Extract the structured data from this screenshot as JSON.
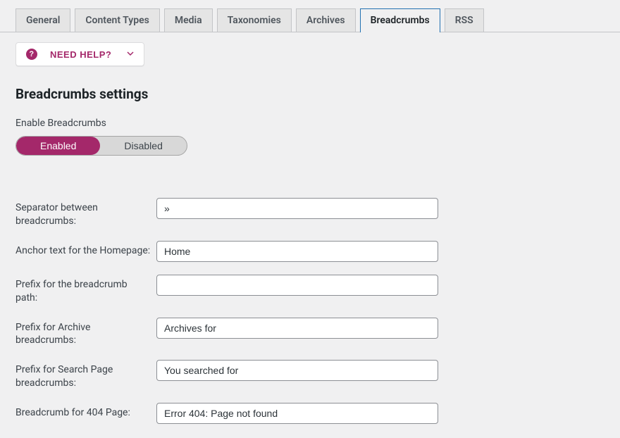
{
  "tabs": [
    {
      "label": "General"
    },
    {
      "label": "Content Types"
    },
    {
      "label": "Media"
    },
    {
      "label": "Taxonomies"
    },
    {
      "label": "Archives"
    },
    {
      "label": "Breadcrumbs"
    },
    {
      "label": "RSS"
    }
  ],
  "help_button": {
    "label": "NEED HELP?"
  },
  "section_title": "Breadcrumbs settings",
  "enable_label": "Enable Breadcrumbs",
  "toggle": {
    "enabled": "Enabled",
    "disabled": "Disabled"
  },
  "fields": {
    "separator": {
      "label": "Separator between breadcrumbs:",
      "value": "»"
    },
    "anchor": {
      "label": "Anchor text for the Homepage:",
      "value": "Home"
    },
    "prefix_path": {
      "label": "Prefix for the breadcrumb path:",
      "value": ""
    },
    "prefix_archive": {
      "label": "Prefix for Archive breadcrumbs:",
      "value": "Archives for"
    },
    "prefix_search": {
      "label": "Prefix for Search Page breadcrumbs:",
      "value": "You searched for"
    },
    "bc_404": {
      "label": "Breadcrumb for 404 Page:",
      "value": "Error 404: Page not found"
    }
  }
}
